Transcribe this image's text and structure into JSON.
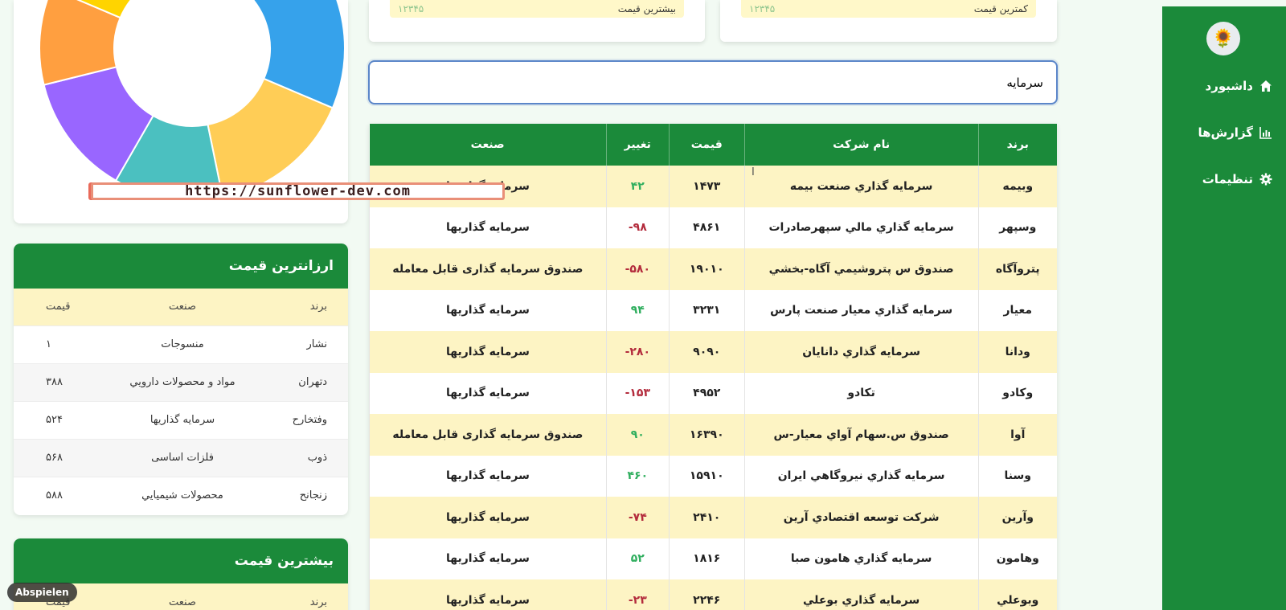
{
  "sidebar": {
    "logo": "🌻",
    "items": [
      {
        "label": "داشبورد",
        "icon": "home-icon"
      },
      {
        "label": "گزارش‌ها",
        "icon": "chart-icon"
      },
      {
        "label": "تنظیمات",
        "icon": "gear-icon"
      }
    ]
  },
  "top_cards": [
    {
      "label": "کمترین قیمت",
      "value": "۱۲۳۴۵"
    },
    {
      "label": "بیشترین قیمت",
      "value": "۱۲۳۴۵"
    }
  ],
  "search": {
    "value": "سرمایه"
  },
  "main_table": {
    "headers": [
      "برند",
      "نام شرکت",
      "قیمت",
      "تغییر",
      "صنعت"
    ],
    "rows": [
      {
        "brand": "وبیمه",
        "name": "سرمايه گذاري صنعت بيمه",
        "price": "۱۴۷۳",
        "change": "۴۲",
        "industry": "سرمایه گذاریها"
      },
      {
        "brand": "وسپهر",
        "name": "سرمايه گذاري مالي سپهرصادرات",
        "price": "۴۸۶۱",
        "change": "۹۸-",
        "industry": "سرمایه گذاریها"
      },
      {
        "brand": "پتروآگاه",
        "name": "صندوق س پتروشيمي آگاه-بخشي",
        "price": "۱۹۰۱۰",
        "change": "۵۸۰-",
        "industry": "صندوق سرمایه گذاری قابل معامله"
      },
      {
        "brand": "معيار",
        "name": "سرمايه گذاري معيار صنعت پارس",
        "price": "۳۲۳۱",
        "change": "۹۴",
        "industry": "سرمایه گذاریها"
      },
      {
        "brand": "ودانا",
        "name": "سرمايه گذاري دانايان",
        "price": "۹۰۹۰",
        "change": "۲۸۰-",
        "industry": "سرمایه گذاریها"
      },
      {
        "brand": "وكادو",
        "name": "تكادو",
        "price": "۴۹۵۲",
        "change": "۱۵۳-",
        "industry": "سرمایه گذاریها"
      },
      {
        "brand": "آوا",
        "name": "صندوق س.سهام آواي معيار-س",
        "price": "۱۶۳۹۰",
        "change": "۹۰",
        "industry": "صندوق سرمایه گذاری قابل معامله"
      },
      {
        "brand": "وسنا",
        "name": "سرمايه گذاري نيروگاهي ايران",
        "price": "۱۵۹۱۰",
        "change": "۴۶۰",
        "industry": "سرمایه گذاریها"
      },
      {
        "brand": "وآرين",
        "name": "شركت توسعه اقتصادي آرين",
        "price": "۲۴۱۰",
        "change": "۷۴-",
        "industry": "سرمایه گذاریها"
      },
      {
        "brand": "وهامون",
        "name": "سرمايه گذاري هامون صبا",
        "price": "۱۸۱۶",
        "change": "۵۲",
        "industry": "سرمایه گذاریها"
      },
      {
        "brand": "وبوعلي",
        "name": "سرمايه گذاري بوعلي",
        "price": "۲۲۴۶",
        "change": "۲۳-",
        "industry": "سرمایه گذاریها"
      }
    ]
  },
  "watermark": "https://sunflower-dev.com",
  "cheapest": {
    "title": "ارزانترین قیمت",
    "headers": [
      "برند",
      "صنعت",
      "قیمت"
    ],
    "rows": [
      {
        "brand": "نشار",
        "industry": "منسوجات",
        "price": "۱"
      },
      {
        "brand": "دتهران",
        "industry": "مواد و محصولات دارويي",
        "price": "۳۸۸"
      },
      {
        "brand": "وفتخارح",
        "industry": "سرمایه گذاریها",
        "price": "۵۲۴"
      },
      {
        "brand": "ذوب",
        "industry": "فلزات اساسی",
        "price": "۵۶۸"
      },
      {
        "brand": "زنجانح",
        "industry": "محصولات شيميايي",
        "price": "۵۸۸"
      }
    ]
  },
  "expensive": {
    "title": "بیشترین قیمت",
    "headers": [
      "برند",
      "صنعت",
      "قیمت"
    ]
  },
  "play_label": "Abspielen",
  "colors": {
    "green": "#1b8a3a",
    "highlight": "#fdf4c4",
    "positive": "#2fae5e",
    "negative": "#b32b3c"
  },
  "chart_data": {
    "type": "pie",
    "series": [
      {
        "values": [
          9,
          14,
          12,
          9,
          10,
          8,
          9,
          7
        ],
        "colors": [
          "#f7698a",
          "#36a2eb",
          "#ffcd56",
          "#4bc0c0",
          "#9966ff",
          "#ff9f40",
          "#ffd400",
          "#4dd8d6"
        ]
      }
    ]
  }
}
